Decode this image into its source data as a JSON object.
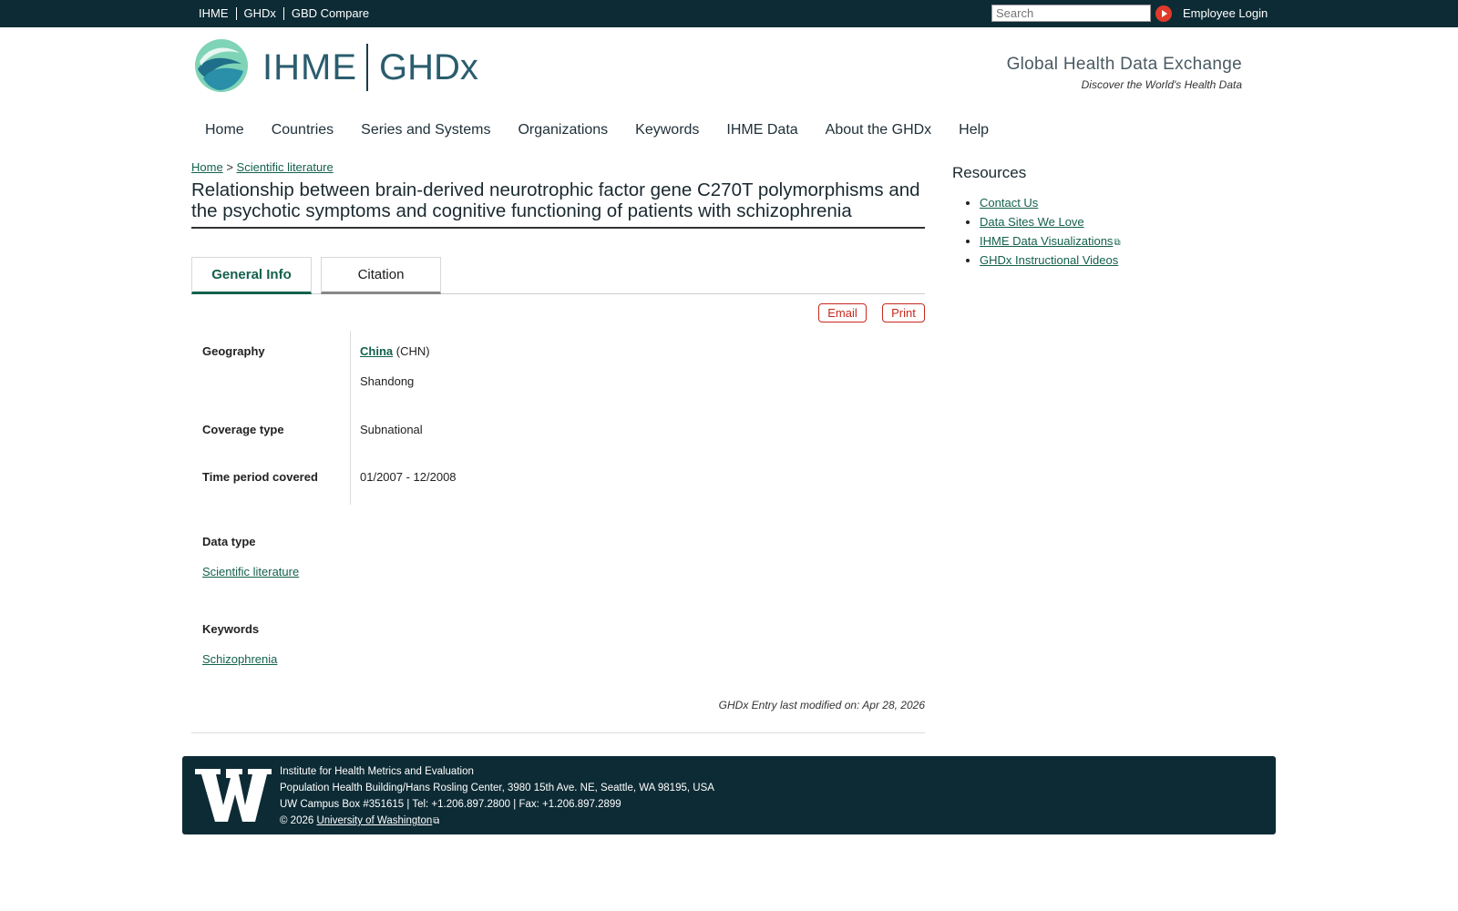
{
  "topbar": {
    "links": [
      "IHME",
      "GHDx",
      "GBD Compare"
    ],
    "search_placeholder": "Search",
    "employee_login": "Employee Login"
  },
  "header": {
    "logo_ihme": "IHME",
    "logo_ghdx": "GHDx",
    "tagline_title": "Global Health Data Exchange",
    "tagline_sub": "Discover the World's Health Data"
  },
  "nav": {
    "items": [
      "Home",
      "Countries",
      "Series and Systems",
      "Organizations",
      "Keywords",
      "IHME Data",
      "About the GHDx",
      "Help"
    ]
  },
  "breadcrumb": {
    "home": "Home",
    "separator": ">",
    "current": "Scientific literature"
  },
  "page": {
    "title": "Relationship between brain-derived neurotrophic factor gene C270T polymorphisms and the psychotic symptoms and cognitive functioning of patients with schizophrenia"
  },
  "tabs": [
    "General Info",
    "Citation"
  ],
  "actions": {
    "email": "Email",
    "print": "Print"
  },
  "fields": {
    "geography_label": "Geography",
    "geography_country": "China",
    "geography_code": "(CHN)",
    "geography_region": "Shandong",
    "coverage_label": "Coverage type",
    "coverage_value": "Subnational",
    "period_label": "Time period covered",
    "period_value": "01/2007 - 12/2008"
  },
  "data_type": {
    "label": "Data type",
    "value": "Scientific literature"
  },
  "keywords": {
    "label": "Keywords",
    "value": "Schizophrenia"
  },
  "modified": "GHDx Entry last modified on: Apr 28, 2026",
  "sidebar": {
    "title": "Resources",
    "items": [
      "Contact Us",
      "Data Sites We Love",
      "IHME Data Visualizations",
      "GHDx Instructional Videos"
    ]
  },
  "footer": {
    "line1": "Institute for Health Metrics and Evaluation",
    "line2": "Population Health Building/Hans Rosling Center, 3980 15th Ave. NE, Seattle, WA 98195, USA",
    "line3": "UW Campus Box #351615 | Tel: +1.206.897.2800 | Fax: +1.206.897.2899",
    "copyright": "© 2026",
    "uw_link": "University of Washington"
  },
  "colors": {
    "topbar_bg": "#0d2b35",
    "link_green": "#14614d",
    "action_red": "#c8281e"
  }
}
